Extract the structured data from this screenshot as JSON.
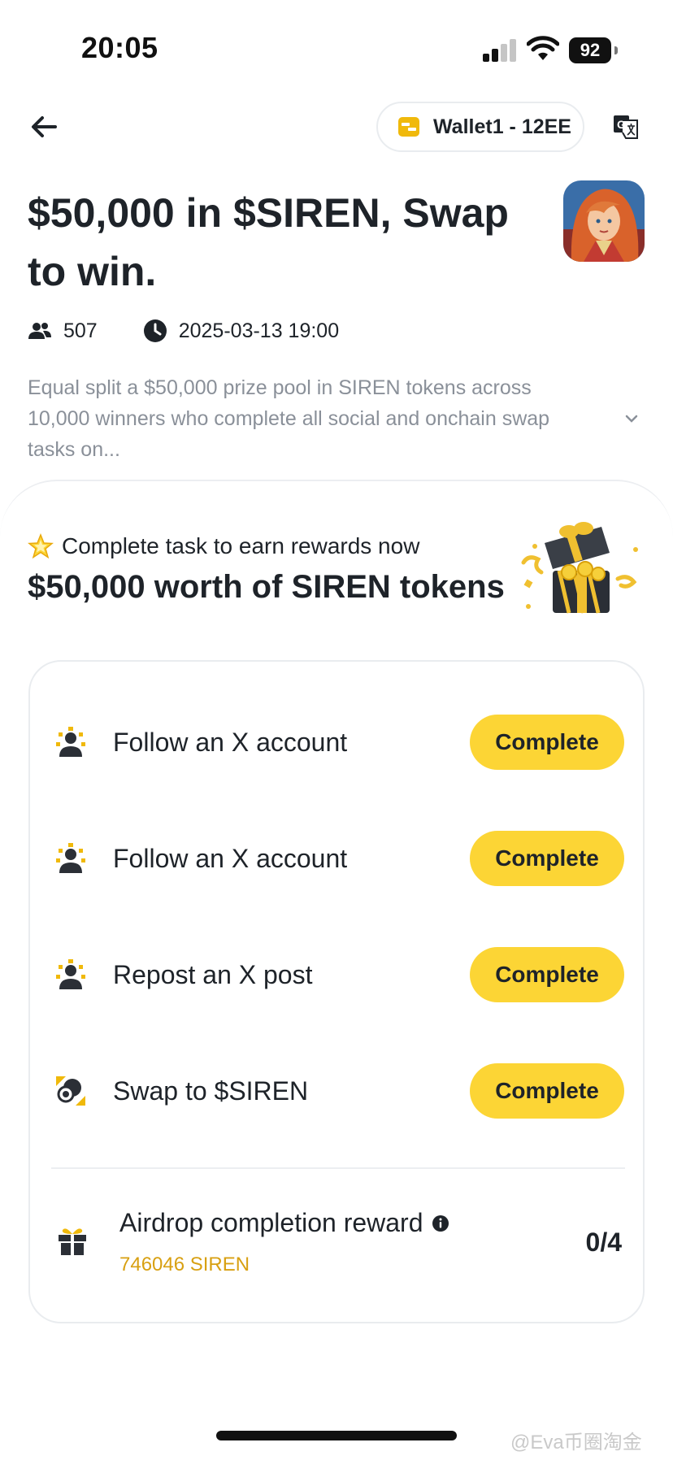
{
  "status_bar": {
    "time": "20:05",
    "battery": "92"
  },
  "header": {
    "wallet_label": "Wallet1 - 12EE"
  },
  "campaign": {
    "title": "$50,000 in $SIREN, Swap to win.",
    "participants": "507",
    "end_time": "2025-03-13 19:00",
    "description": "Equal split a $50,000 prize pool in SIREN tokens across 10,000 winners who complete all social and onchain swap tasks on..."
  },
  "rewards": {
    "subtitle": "Complete task to earn rewards now",
    "headline": "$50,000 worth of SIREN tokens"
  },
  "tasks": [
    {
      "label": "Follow an X account",
      "button": "Complete",
      "icon": "people-icon"
    },
    {
      "label": "Follow an X account",
      "button": "Complete",
      "icon": "people-icon"
    },
    {
      "label": "Repost an X post",
      "button": "Complete",
      "icon": "people-icon"
    },
    {
      "label": "Swap to $SIREN",
      "button": "Complete",
      "icon": "swap-icon"
    }
  ],
  "airdrop": {
    "title": "Airdrop completion reward",
    "amount": "746046 SIREN",
    "progress": "0/4"
  },
  "watermark": "@Eva币圈淘金",
  "colors": {
    "accent": "#fcd535",
    "gold_text": "#d8a012",
    "muted_text": "#8a9099"
  }
}
